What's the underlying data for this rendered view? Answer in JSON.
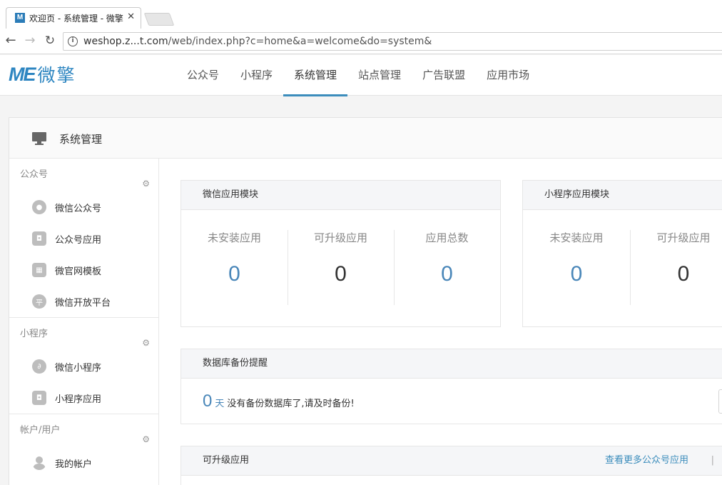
{
  "browser": {
    "tab_title": "欢迎页 - 系统管理 - 微擎",
    "favicon_letter": "M",
    "url_host": "weshop.z...t.com",
    "url_path": "/web/index.php?c=home&a=welcome&do=system&"
  },
  "header": {
    "logo_mark": "ME",
    "logo_text": "微擎",
    "nav": [
      {
        "label": "公众号",
        "active": false
      },
      {
        "label": "小程序",
        "active": false
      },
      {
        "label": "系统管理",
        "active": true
      },
      {
        "label": "站点管理",
        "active": false
      },
      {
        "label": "广告联盟",
        "active": false
      },
      {
        "label": "应用市场",
        "active": false
      }
    ]
  },
  "panel": {
    "title": "系统管理"
  },
  "sidebar": {
    "groups": [
      {
        "title": "公众号",
        "items": [
          {
            "label": "微信公众号",
            "icon": "wechat-icon"
          },
          {
            "label": "公众号应用",
            "icon": "bag-icon"
          },
          {
            "label": "微官网模板",
            "icon": "template-icon"
          },
          {
            "label": "微信开放平台",
            "icon": "platform-icon"
          }
        ]
      },
      {
        "title": "小程序",
        "items": [
          {
            "label": "微信小程序",
            "icon": "miniprogram-icon"
          },
          {
            "label": "小程序应用",
            "icon": "bag-icon"
          }
        ]
      },
      {
        "title": "帐户/用户",
        "items": [
          {
            "label": "我的帐户",
            "icon": "user-icon"
          }
        ]
      }
    ]
  },
  "wechat_modules": {
    "title": "微信应用模块",
    "stats": [
      {
        "label": "未安装应用",
        "value": "0"
      },
      {
        "label": "可升级应用",
        "value": "0"
      },
      {
        "label": "应用总数",
        "value": "0"
      }
    ]
  },
  "mini_modules": {
    "title": "小程序应用模块",
    "stats": [
      {
        "label": "未安装应用",
        "value": "0"
      },
      {
        "label": "可升级应用",
        "value": "0"
      }
    ]
  },
  "backup": {
    "title": "数据库备份提醒",
    "days": "0",
    "unit": "天",
    "message": "没有备份数据库了,请及时备份!"
  },
  "upgradable": {
    "title": "可升级应用",
    "more_link": "查看更多公众号应用",
    "separator": "|"
  },
  "colors": {
    "accent": "#3c8dbc",
    "stat_blue": "#4a87b9"
  }
}
